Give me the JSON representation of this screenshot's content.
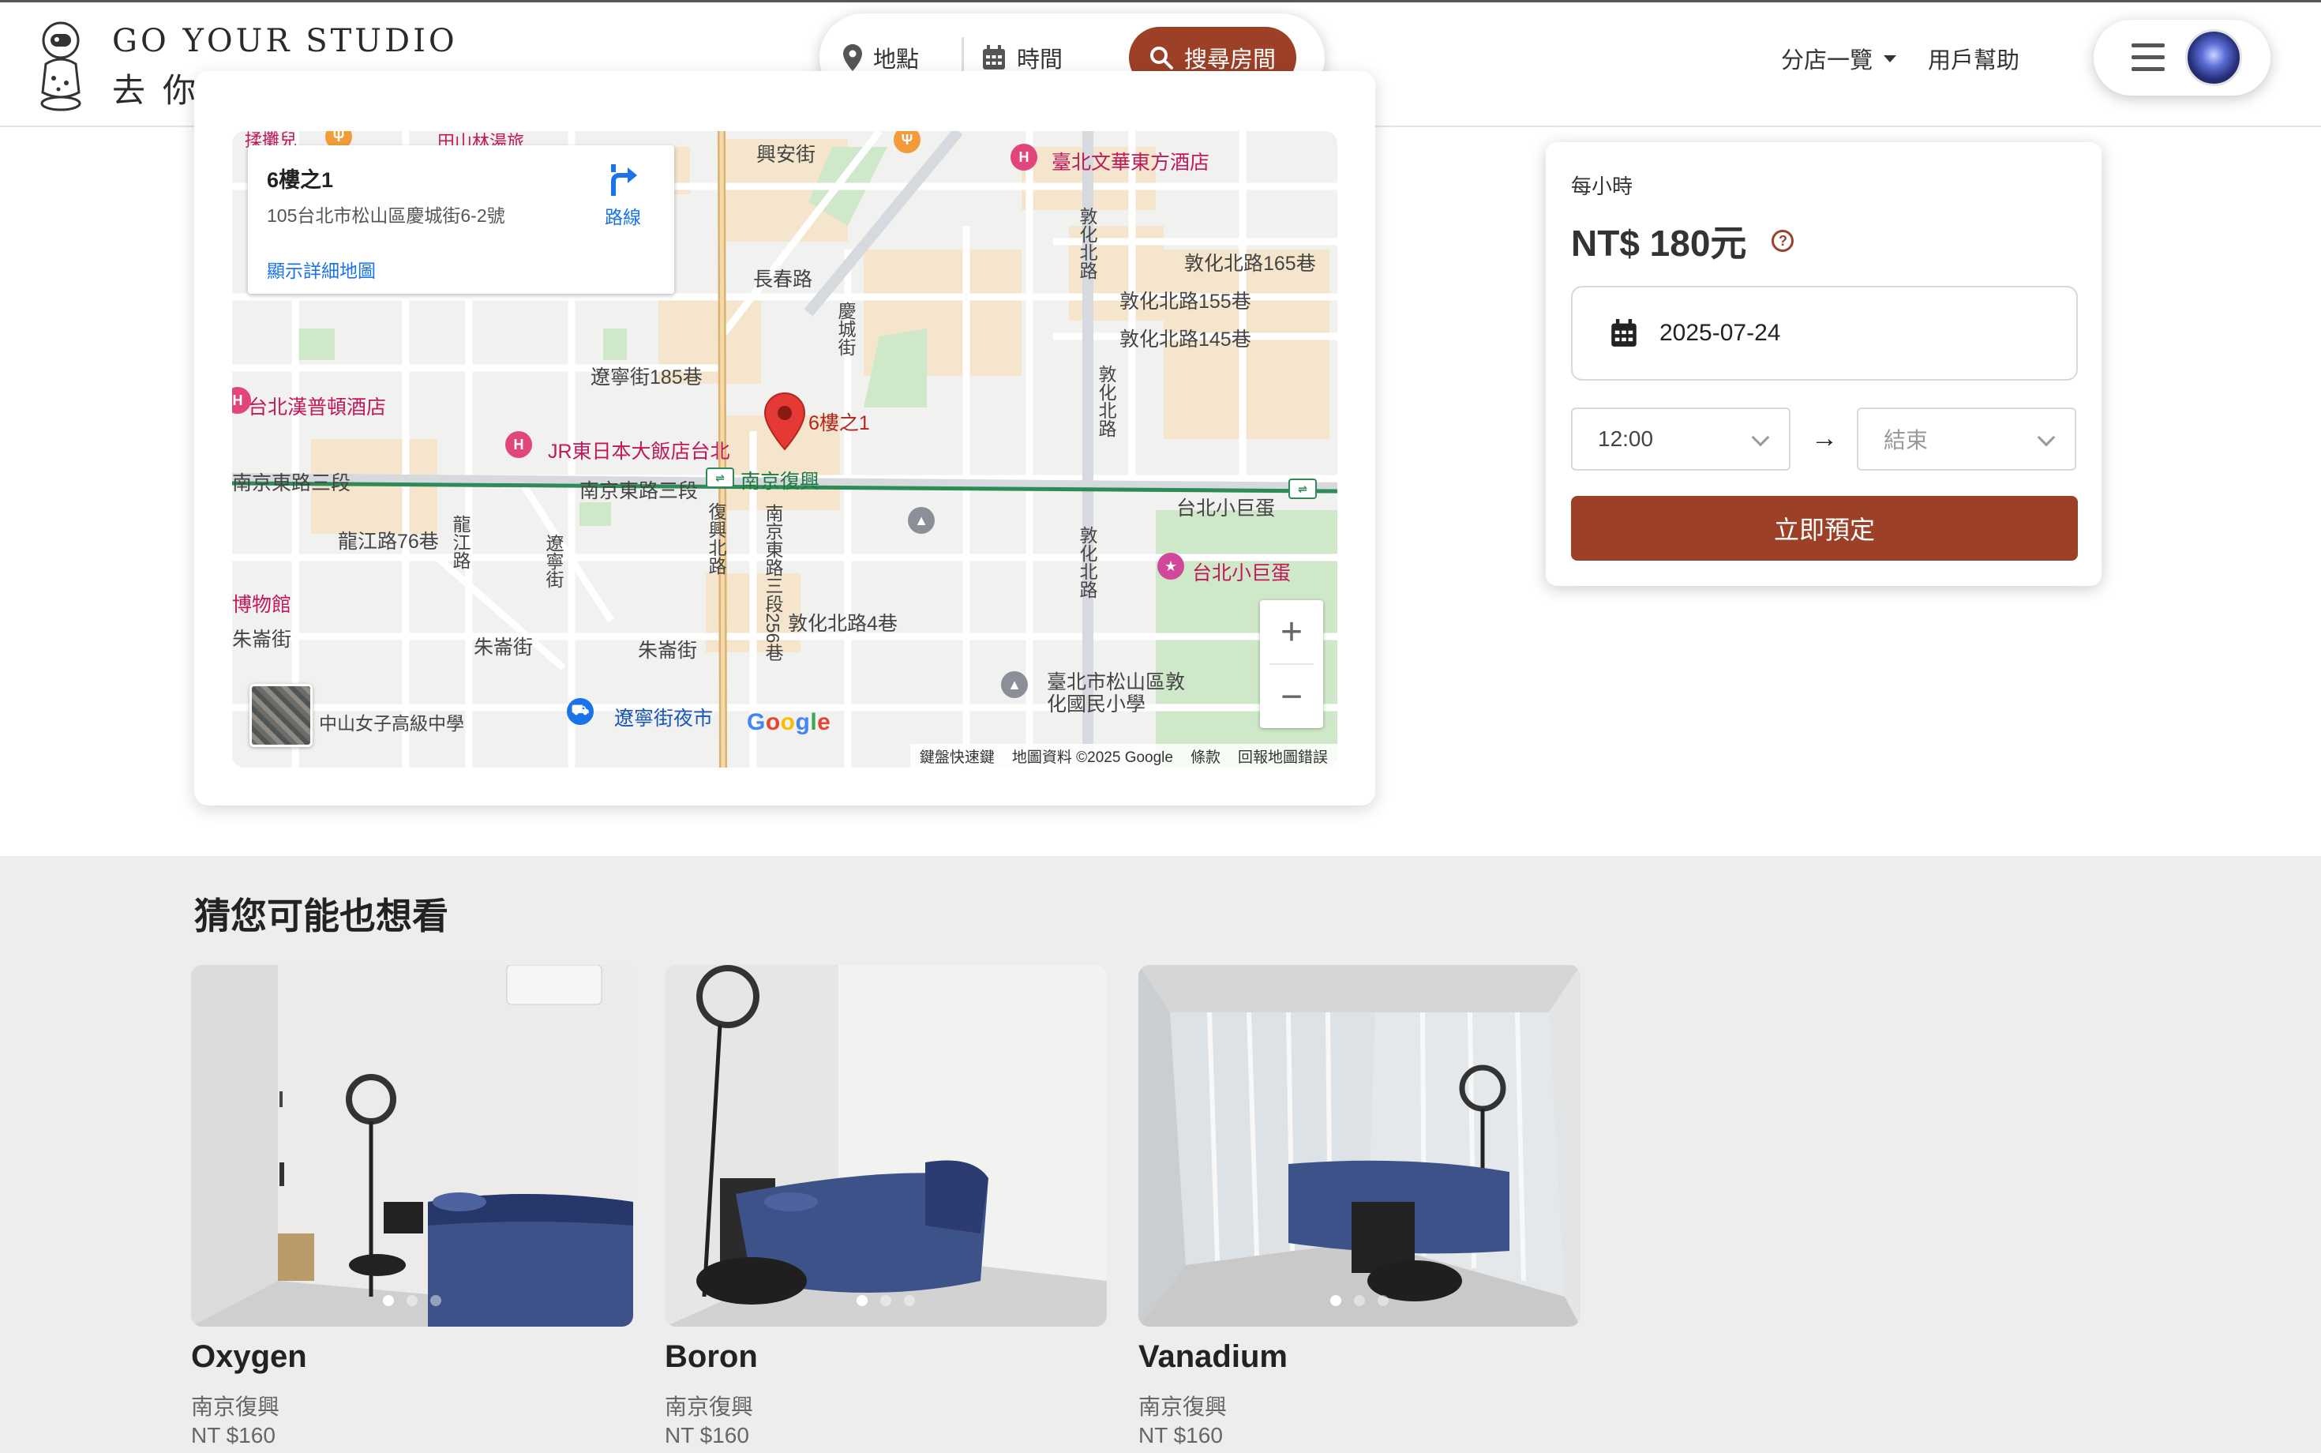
{
  "brand": {
    "name_en": "GO YOUR STUDIO",
    "name_zh": "去你的工作室"
  },
  "search": {
    "location_label": "地點",
    "time_label": "時間",
    "button_label": "搜尋房間"
  },
  "nav": {
    "branches_label": "分店一覽",
    "help_label": "用戶幫助"
  },
  "map": {
    "info_title": "6樓之1",
    "info_address": "105台北市松山區慶城街6-2號",
    "info_link": "顯示詳細地圖",
    "info_directions": "路線",
    "marker_label": "6樓之1",
    "labels": {
      "xingan": "興安街",
      "changchun": "長春路",
      "qingcheng": "慶城街",
      "liaoning185": "遼寧街185巷",
      "dunhua165": "敦化北路165巷",
      "dunhua155": "敦化北路155巷",
      "dunhua145": "敦化北路145巷",
      "dunhua_n": "敦化北路",
      "nanjing3": "南京東路三段",
      "nanjing_fuxing": "南京復興",
      "longjiang76": "龍江路76巷",
      "liaoning": "遼寧街",
      "fuxing_n": "復興北路",
      "nanjing256": "南京東路三段256巷",
      "dunhua4": "敦化北路4巷",
      "zhuyun": "朱崙街",
      "longjiang": "龍江路",
      "museum": "博物館",
      "arena": "台北小巨蛋",
      "arena_station": "台北小巨蛋",
      "hotel_mandarin": "臺北文華東方酒店",
      "hotel_sheraton": "台北漢普頓酒店",
      "hotel_jr": "JR東日本大飯店台北",
      "school_songshan": "臺北市松山區敦化國民小學",
      "night_market": "遼寧街夜市",
      "school_zhongshan": "中山女子高級中學",
      "top_left_a": "揉攤兒",
      "top_left_b": "田山林湯旅"
    },
    "google_logo": "Google",
    "attribution": [
      "鍵盤快速鍵",
      "地圖資料 ©2025 Google",
      "條款",
      "回報地圖錯誤"
    ]
  },
  "booking": {
    "per_label": "每小時",
    "price": "NT$ 180元",
    "help_icon": "?",
    "date": "2025-07-24",
    "start_time": "12:00",
    "end_placeholder": "結束",
    "arrow": "→",
    "book_button": "立即預定"
  },
  "recommendations": {
    "title": "猜您可能也想看",
    "items": [
      {
        "name": "Oxygen",
        "location": "南京復興",
        "price": "NT $160"
      },
      {
        "name": "Boron",
        "location": "南京復興",
        "price": "NT $160"
      },
      {
        "name": "Vanadium",
        "location": "南京復興",
        "price": "NT $160"
      }
    ]
  },
  "colors": {
    "brand": "#9c4128",
    "map_bg": "#f1f1ef",
    "road": "#ffffff",
    "park": "#cfe8c9",
    "block": "#f4e5cc"
  },
  "icons": {
    "location": "map-pin-icon",
    "calendar": "calendar-icon",
    "search": "magnifier-icon",
    "menu": "hamburger-icon"
  }
}
